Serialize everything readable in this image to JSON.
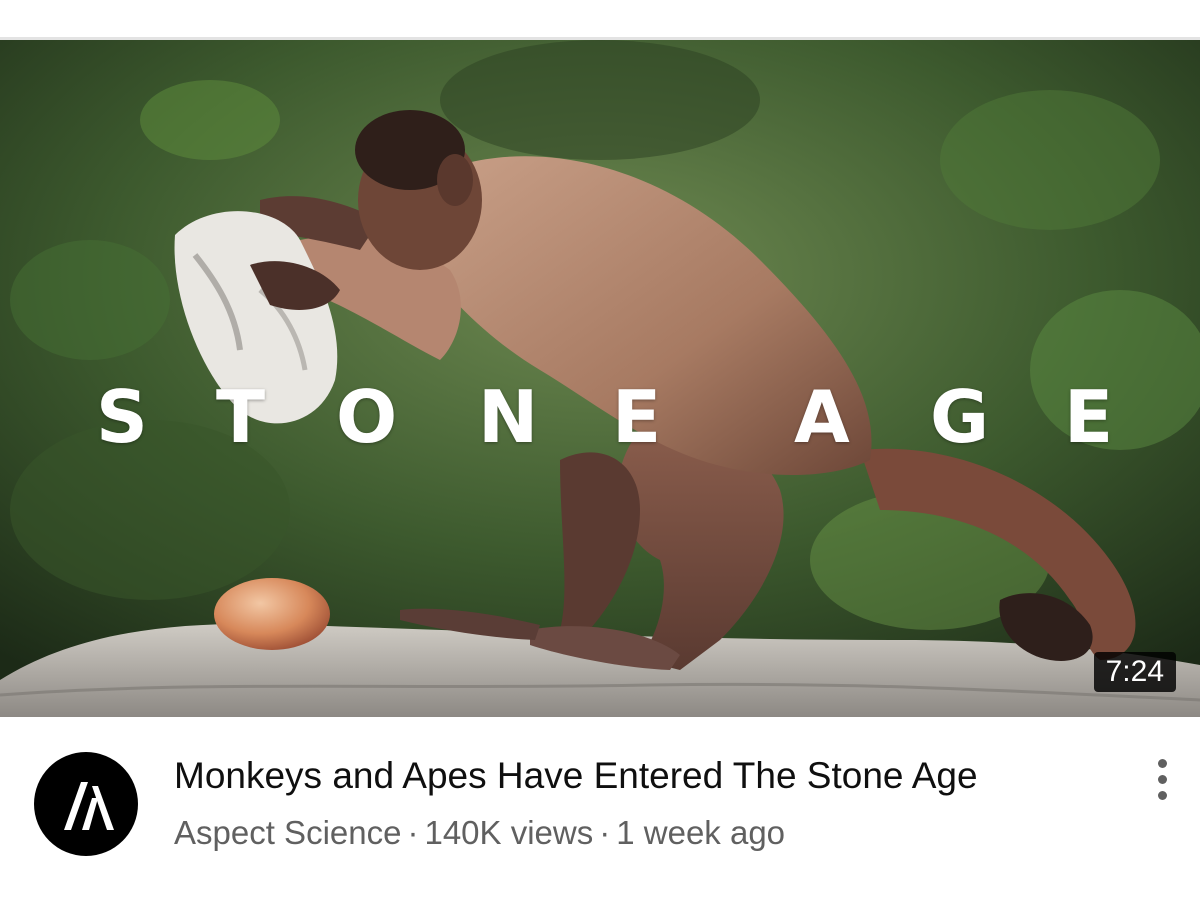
{
  "video": {
    "overlay_title": [
      "S",
      "T",
      "O",
      "N",
      "E",
      "A",
      "G",
      "E"
    ],
    "duration": "7:24",
    "title": "Monkeys and Apes Have Entered The Stone Age",
    "channel": "Aspect Science",
    "separator": "·",
    "views": "140K views",
    "age": "1 week ago"
  },
  "icons": {
    "avatar": "aspect-science-logo",
    "more": "more-vertical-icon"
  },
  "colors": {
    "title_text": "#0f0f0f",
    "meta_text": "#606060",
    "badge_bg": "#000000",
    "avatar_bg": "#000000"
  }
}
